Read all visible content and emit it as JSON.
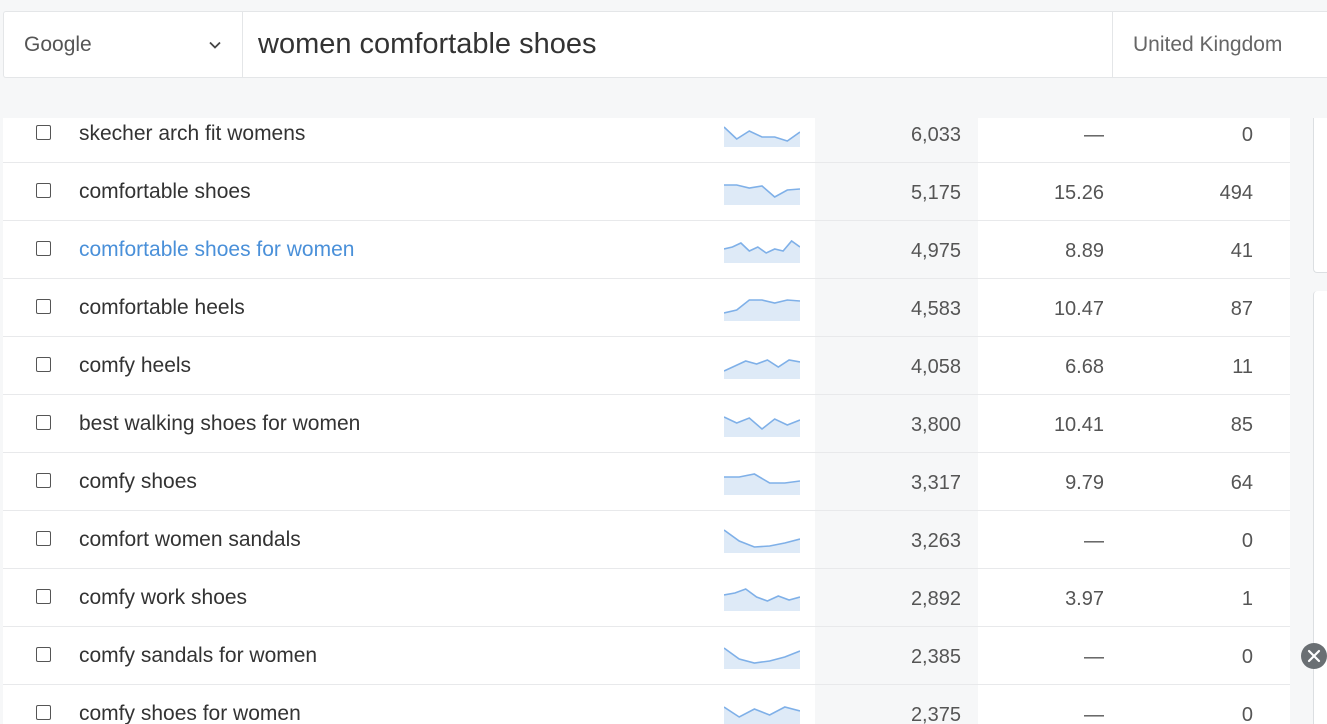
{
  "search": {
    "engine": "Google",
    "query": "women comfortable shoes",
    "country": "United Kingdom"
  },
  "colors": {
    "link": "#4a90d9",
    "spark_line": "#7fb0e8",
    "spark_fill": "#deeaf7"
  },
  "rows": [
    {
      "keyword": "skecher arch fit womens",
      "volume": "6,033",
      "cpc": "—",
      "results": "0",
      "link": false,
      "trend": [
        0.8,
        0.2,
        0.6,
        0.3,
        0.3,
        0.1,
        0.55
      ]
    },
    {
      "keyword": "comfortable shoes",
      "volume": "5,175",
      "cpc": "15.26",
      "results": "494",
      "link": false,
      "trend": [
        0.8,
        0.8,
        0.65,
        0.75,
        0.2,
        0.55,
        0.6
      ]
    },
    {
      "keyword": "comfortable shoes for women",
      "volume": "4,975",
      "cpc": "8.89",
      "results": "41",
      "link": true,
      "trend": [
        0.5,
        0.6,
        0.8,
        0.4,
        0.6,
        0.3,
        0.5,
        0.4,
        0.9,
        0.6
      ]
    },
    {
      "keyword": "comfortable heels",
      "volume": "4,583",
      "cpc": "10.47",
      "results": "87",
      "link": false,
      "trend": [
        0.2,
        0.35,
        0.85,
        0.85,
        0.7,
        0.85,
        0.8
      ]
    },
    {
      "keyword": "comfy heels",
      "volume": "4,058",
      "cpc": "6.68",
      "results": "11",
      "link": false,
      "trend": [
        0.2,
        0.45,
        0.7,
        0.55,
        0.75,
        0.4,
        0.75,
        0.65
      ]
    },
    {
      "keyword": "best walking shoes for women",
      "volume": "3,800",
      "cpc": "10.41",
      "results": "85",
      "link": false,
      "trend": [
        0.8,
        0.5,
        0.75,
        0.2,
        0.7,
        0.4,
        0.65
      ]
    },
    {
      "keyword": "comfy shoes",
      "volume": "3,317",
      "cpc": "9.79",
      "results": "64",
      "link": false,
      "trend": [
        0.7,
        0.7,
        0.85,
        0.4,
        0.4,
        0.5
      ]
    },
    {
      "keyword": "comfort women sandals",
      "volume": "3,263",
      "cpc": "—",
      "results": "0",
      "link": false,
      "trend": [
        0.95,
        0.4,
        0.1,
        0.15,
        0.3,
        0.5
      ]
    },
    {
      "keyword": "comfy work shoes",
      "volume": "2,892",
      "cpc": "3.97",
      "results": "1",
      "link": false,
      "trend": [
        0.6,
        0.7,
        0.9,
        0.5,
        0.3,
        0.55,
        0.35,
        0.5
      ]
    },
    {
      "keyword": "comfy sandals for women",
      "volume": "2,385",
      "cpc": "—",
      "results": "0",
      "link": false,
      "trend": [
        0.85,
        0.3,
        0.1,
        0.2,
        0.4,
        0.7
      ]
    },
    {
      "keyword": "comfy shoes for women",
      "volume": "2,375",
      "cpc": "—",
      "results": "0",
      "link": false,
      "trend": [
        0.8,
        0.3,
        0.7,
        0.4,
        0.8,
        0.6
      ]
    }
  ]
}
